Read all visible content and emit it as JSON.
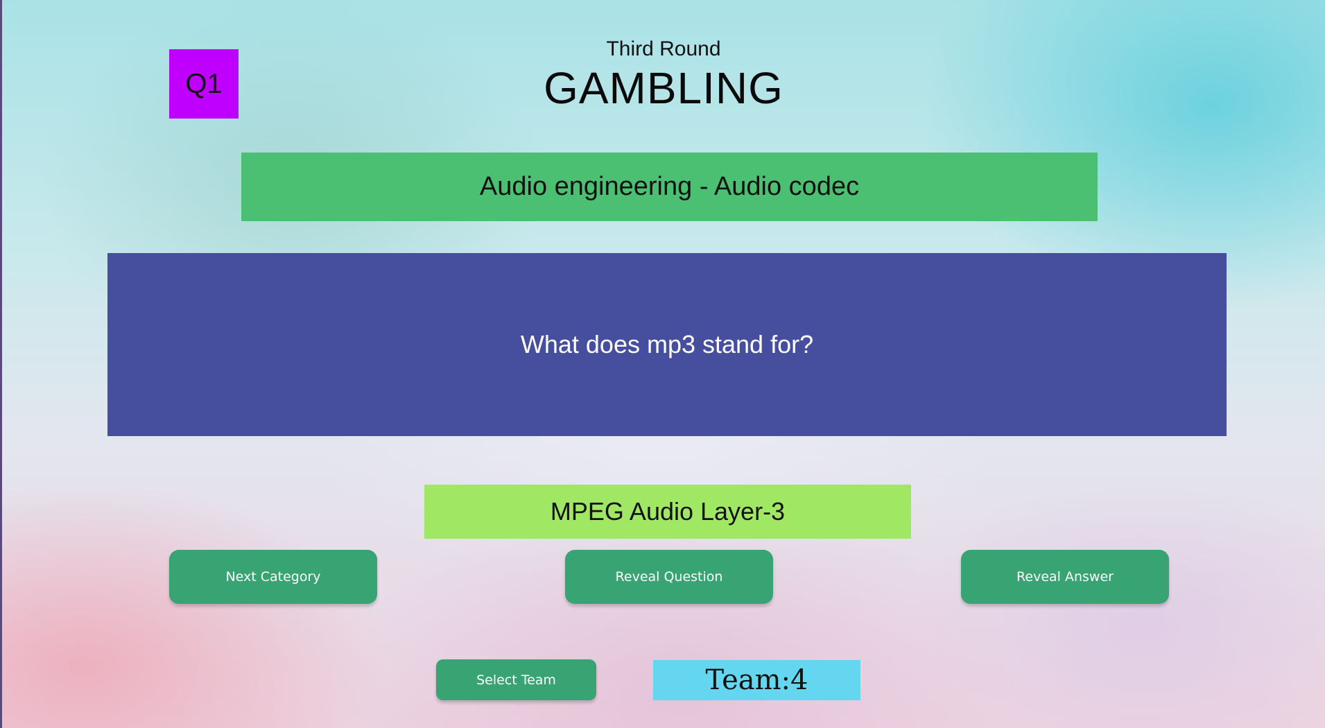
{
  "question_badge": "Q1",
  "round": {
    "label": "Third Round",
    "title": "GAMBLING"
  },
  "category": "Audio engineering - Audio codec",
  "question": "What does mp3 stand for?",
  "answer": "MPEG Audio Layer-3",
  "buttons": {
    "next_category": "Next Category",
    "reveal_question": "Reveal Question",
    "reveal_answer": "Reveal Answer",
    "select_team": "Select Team"
  },
  "team_display": "Team:4",
  "colors": {
    "badge": "#c000ff",
    "category_bar": "#4cc072",
    "question_box": "#464f9d",
    "answer_box": "#a0e864",
    "button": "#38a474",
    "team_box": "#64d6f0"
  }
}
